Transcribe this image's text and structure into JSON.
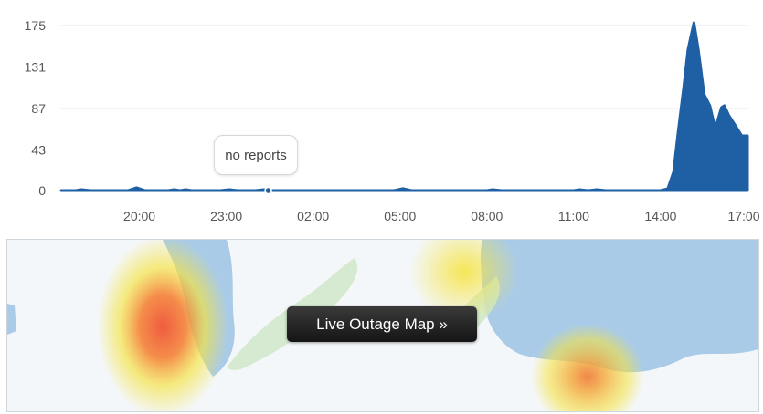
{
  "chart_data": {
    "type": "area",
    "y_ticks": [
      0,
      43,
      87,
      131,
      175
    ],
    "x_tick_labels": [
      "20:00",
      "23:00",
      "02:00",
      "05:00",
      "08:00",
      "11:00",
      "14:00",
      "17:00"
    ],
    "x_tick_hours": [
      20,
      23,
      26,
      29,
      32,
      35,
      38,
      41
    ],
    "ylim": [
      0,
      175
    ],
    "xlim_hours": [
      17.3,
      41.0
    ],
    "grid": true,
    "series_color": "#1f5fa4",
    "points": [
      [
        17.3,
        0
      ],
      [
        17.8,
        0
      ],
      [
        18.0,
        1
      ],
      [
        18.3,
        0
      ],
      [
        19.6,
        0
      ],
      [
        19.9,
        3
      ],
      [
        20.2,
        0
      ],
      [
        21.0,
        0
      ],
      [
        21.2,
        1
      ],
      [
        21.4,
        0
      ],
      [
        21.6,
        1
      ],
      [
        21.8,
        0
      ],
      [
        22.8,
        0
      ],
      [
        23.1,
        1
      ],
      [
        23.4,
        0
      ],
      [
        24.0,
        0
      ],
      [
        24.3,
        1
      ],
      [
        24.5,
        0
      ],
      [
        28.8,
        0
      ],
      [
        29.1,
        2
      ],
      [
        29.4,
        0
      ],
      [
        32.0,
        0
      ],
      [
        32.2,
        1
      ],
      [
        32.5,
        0
      ],
      [
        35.0,
        0
      ],
      [
        35.2,
        1
      ],
      [
        35.5,
        0
      ],
      [
        35.8,
        1
      ],
      [
        36.1,
        0
      ],
      [
        38.0,
        0
      ],
      [
        38.25,
        2
      ],
      [
        38.45,
        20
      ],
      [
        38.6,
        60
      ],
      [
        38.8,
        110
      ],
      [
        38.95,
        150
      ],
      [
        39.15,
        178
      ],
      [
        39.3,
        150
      ],
      [
        39.5,
        102
      ],
      [
        39.7,
        90
      ],
      [
        39.85,
        70
      ],
      [
        39.95,
        72
      ],
      [
        40.1,
        88
      ],
      [
        40.2,
        90
      ],
      [
        40.35,
        80
      ],
      [
        40.6,
        68
      ],
      [
        40.8,
        58
      ],
      [
        41.0,
        58
      ]
    ],
    "marker_hour": 24.45,
    "tooltip": "no reports"
  },
  "map": {
    "button_label": "Live Outage Map »"
  }
}
